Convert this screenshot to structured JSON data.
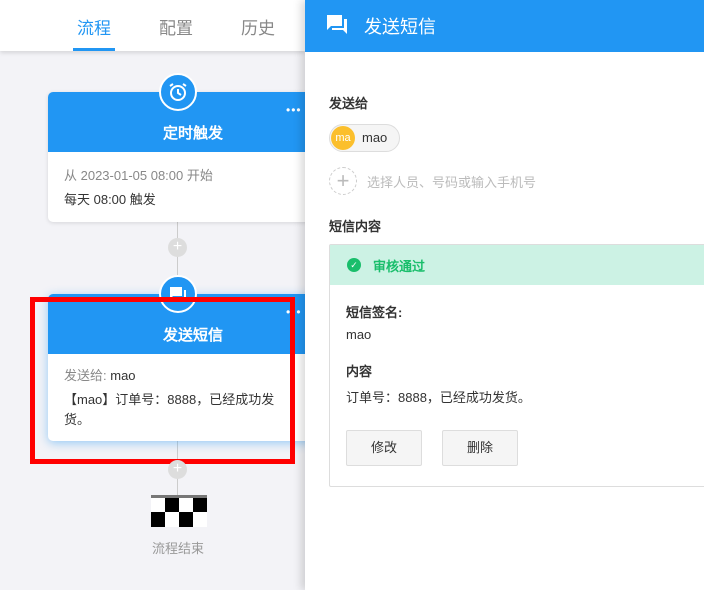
{
  "tabs": [
    {
      "label": "流程"
    },
    {
      "label": "配置"
    },
    {
      "label": "历史"
    }
  ],
  "flow": {
    "trigger": {
      "title": "定时触发",
      "line1": "从 2023-01-05 08:00 开始",
      "line2": "每天 08:00 触发",
      "more": "•••"
    },
    "sms": {
      "title": "发送短信",
      "to_label": "发送给:",
      "to_value": "mao",
      "content": "【mao】订单号：8888，已经成功发货。",
      "more": "•••"
    },
    "end_label": "流程结束"
  },
  "panel": {
    "title": "发送短信",
    "send_to_label": "发送给",
    "recipient": {
      "avatar": "ma",
      "name": "mao"
    },
    "add_placeholder": "选择人员、号码或输入手机号",
    "content_label": "短信内容",
    "status": "审核通过",
    "signature_label": "短信签名:",
    "signature": "mao",
    "body_label": "内容",
    "body": "订单号：8888，已经成功发货。",
    "edit_label": "修改",
    "delete_label": "删除"
  },
  "colors": {
    "primary": "#2196f3",
    "success": "#19be6b",
    "highlight": "#ff0000"
  }
}
